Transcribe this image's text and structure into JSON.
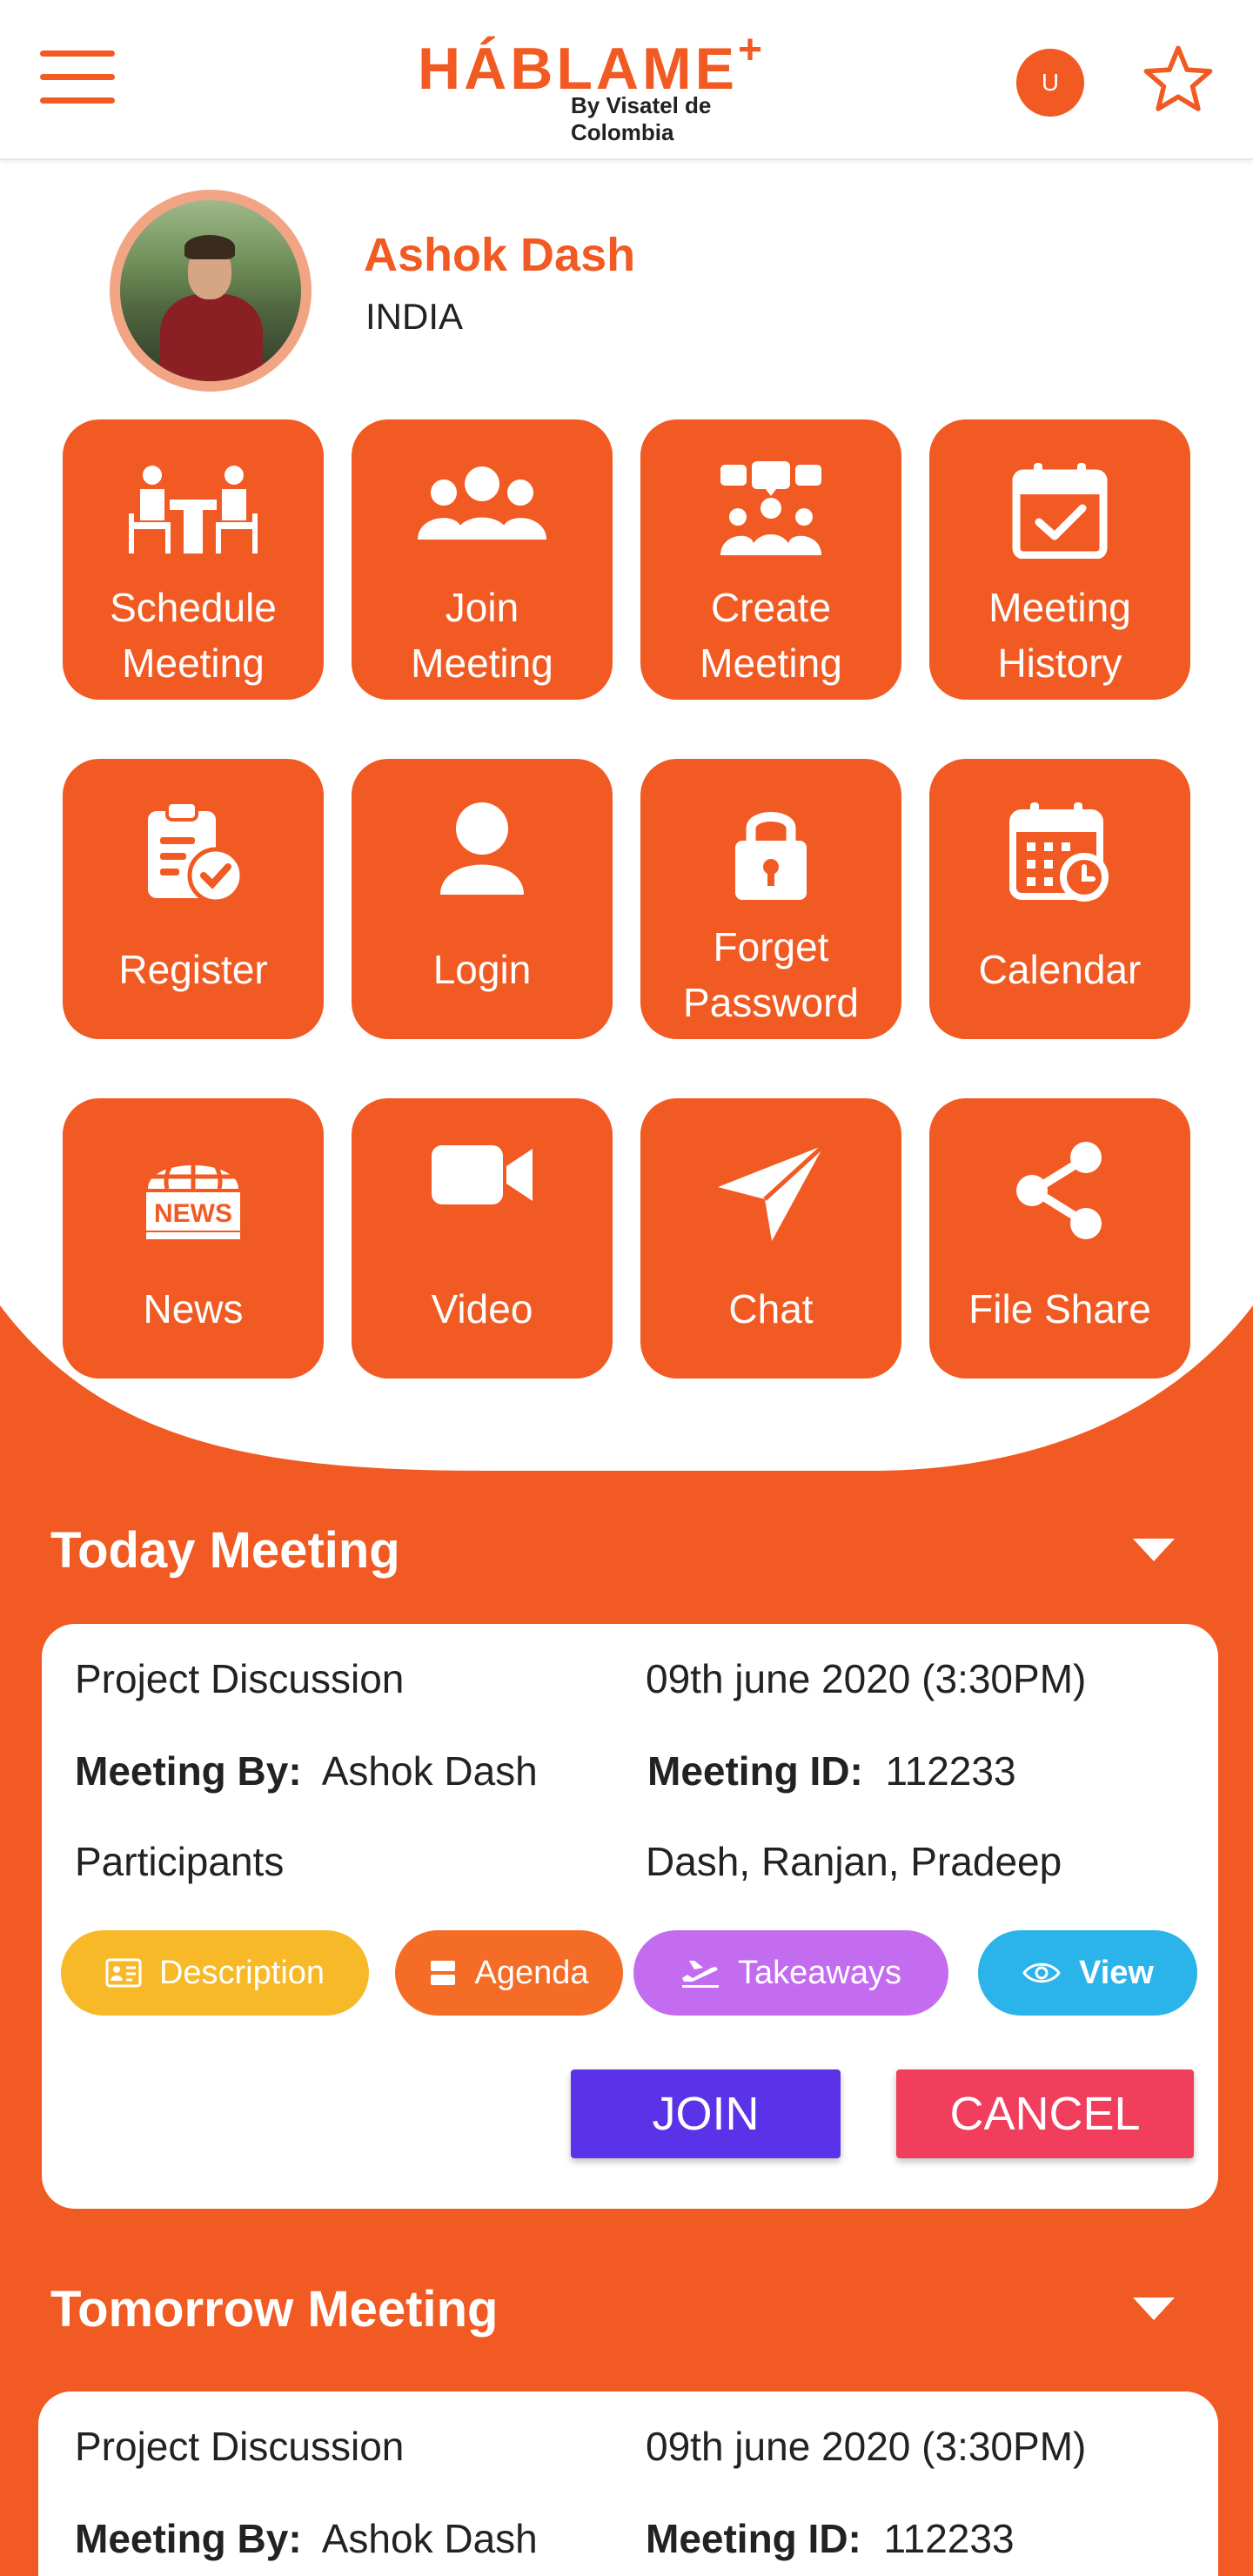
{
  "header": {
    "logo_text": "HÁBLAME",
    "logo_plus": "+",
    "logo_sub": "By Visatel de Colombia",
    "avatar_letter": "U"
  },
  "profile": {
    "name": "Ashok Dash",
    "country": "INDIA"
  },
  "tiles": [
    {
      "line1": "Schedule",
      "line2": "Meeting",
      "icon": "meeting-people-icon"
    },
    {
      "line1": "Join",
      "line2": "Meeting",
      "icon": "group-icon"
    },
    {
      "line1": "Create",
      "line2": "Meeting",
      "icon": "group-chat-icon"
    },
    {
      "line1": "Meeting",
      "line2": "History",
      "icon": "calendar-check-icon"
    },
    {
      "line1": "Register",
      "icon": "clipboard-check-icon"
    },
    {
      "line1": "Login",
      "icon": "user-icon"
    },
    {
      "line1": "Forget",
      "line2": "Password",
      "icon": "lock-icon"
    },
    {
      "line1": "Calendar",
      "icon": "calendar-clock-icon"
    },
    {
      "line1": "News",
      "icon": "news-icon"
    },
    {
      "line1": "Video",
      "icon": "video-icon"
    },
    {
      "line1": "Chat",
      "icon": "send-icon"
    },
    {
      "line1": "File Share",
      "icon": "share-icon"
    }
  ],
  "today": {
    "title": "Today Meeting",
    "meeting_name": "Project Discussion",
    "date": "09th june 2020 (3:30PM)",
    "meeting_by_label": "Meeting By:",
    "meeting_by_value": "Ashok Dash",
    "meeting_id_label": "Meeting ID:",
    "meeting_id_value": "112233",
    "participants_label": "Participants",
    "participants_value": "Dash, Ranjan, Pradeep",
    "pills": {
      "description": "Description",
      "agenda": "Agenda",
      "takeaways": "Takeaways",
      "view": "View"
    },
    "join_label": "JOIN",
    "cancel_label": "CANCEL"
  },
  "tomorrow": {
    "title": "Tomorrow Meeting",
    "meeting_name": "Project Discussion",
    "date": "09th june 2020 (3:30PM)",
    "meeting_by_label": "Meeting By:",
    "meeting_by_value": "Ashok Dash",
    "meeting_id_label": "Meeting ID:",
    "meeting_id_value": "112233"
  },
  "colors": {
    "brand": "#f15a22",
    "description_pill": "#f8b928",
    "agenda_pill": "#f56c26",
    "takeaways_pill": "#c46cf0",
    "view_pill": "#2ab4ea",
    "join": "#5a33e8",
    "cancel": "#f03e5c"
  }
}
